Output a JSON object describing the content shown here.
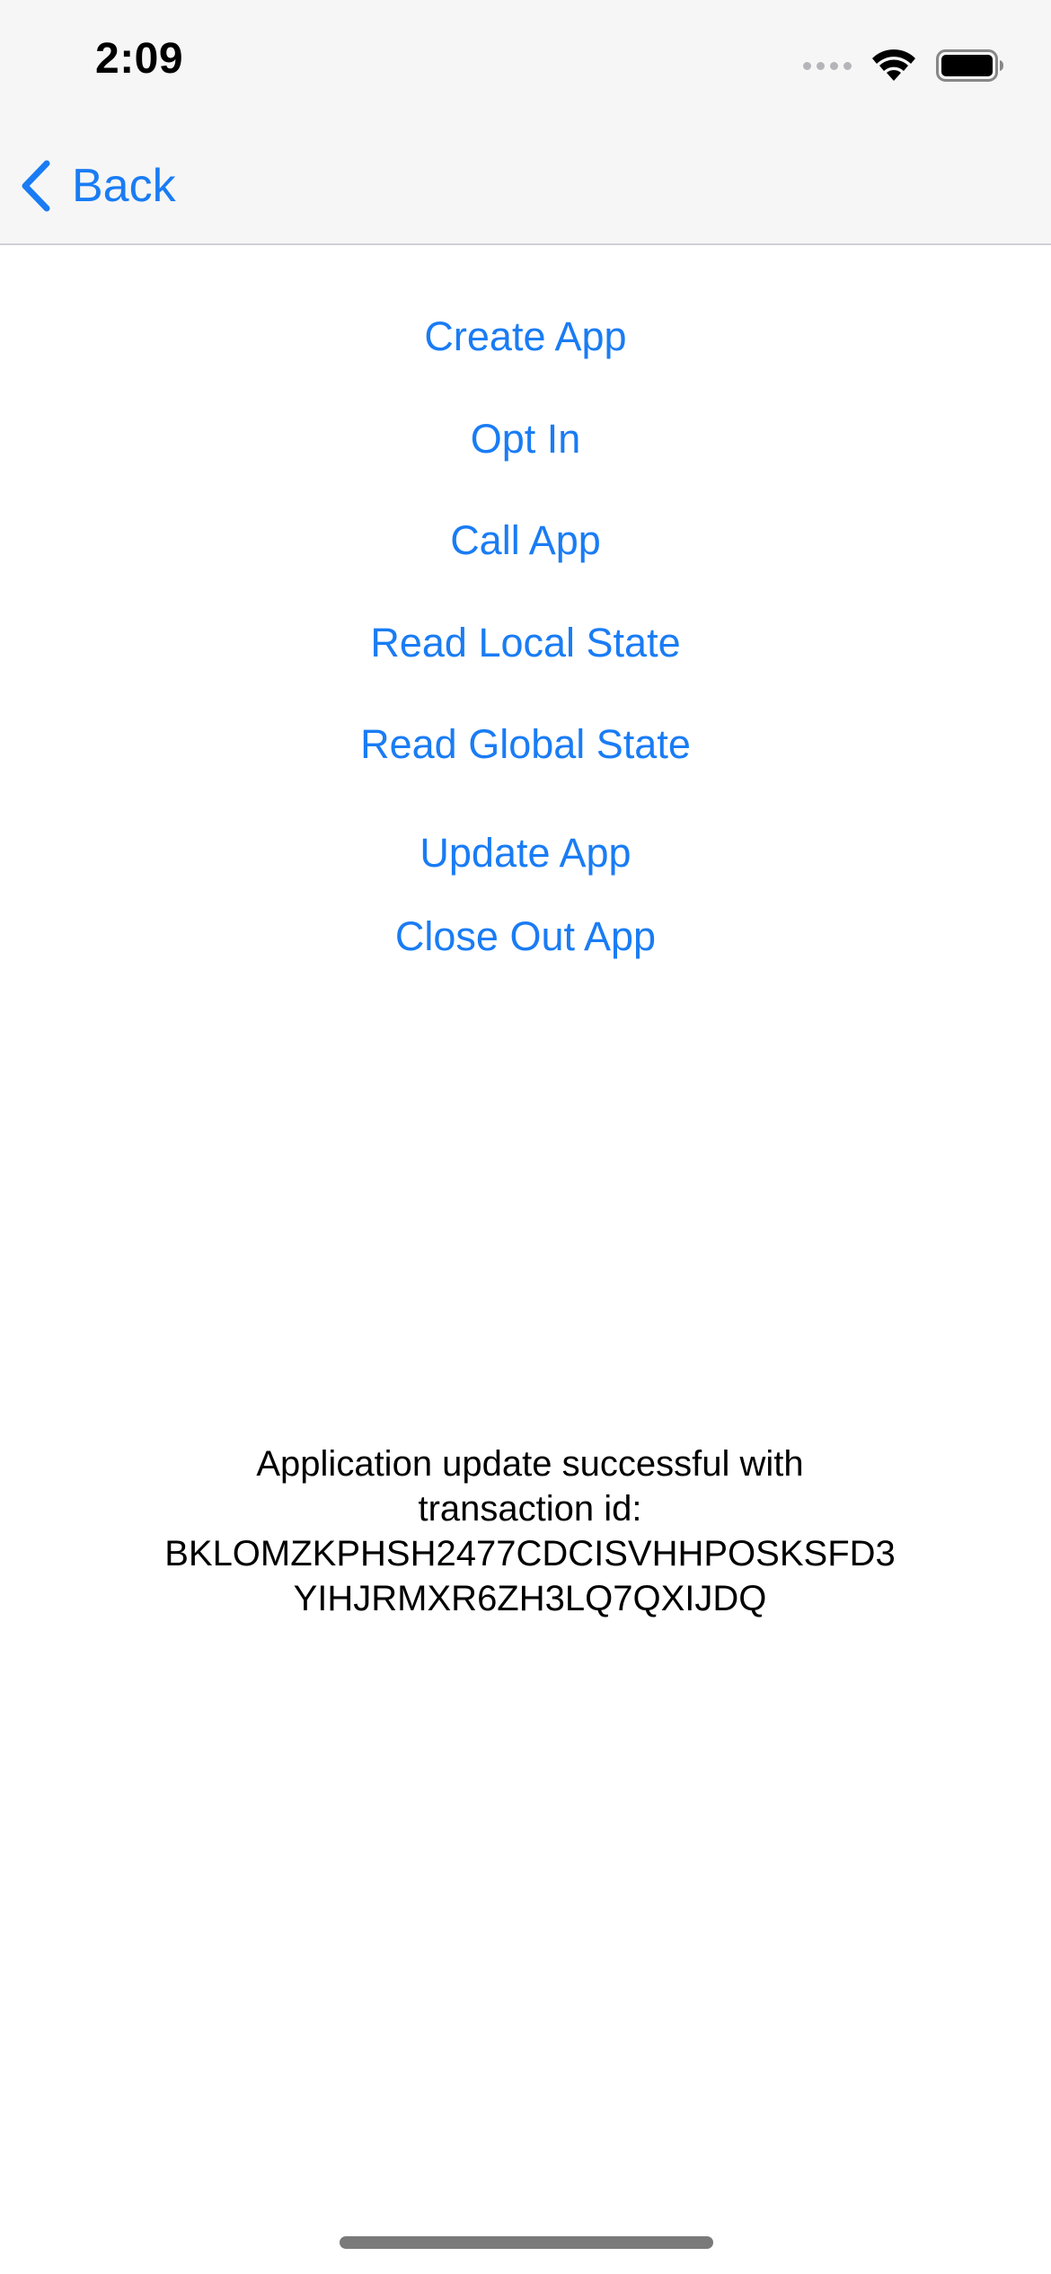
{
  "status_bar": {
    "time": "2:09",
    "icons": [
      "signal-dots-icon",
      "wifi-icon",
      "battery-icon"
    ]
  },
  "nav": {
    "back_label": "Back",
    "accent_color": "#1a7cf4"
  },
  "actions": {
    "create_app": "Create App",
    "opt_in": "Opt In",
    "call_app": "Call App",
    "read_local_state": "Read Local State",
    "read_global_state": "Read Global State",
    "update_app": "Update App",
    "close_out_app": "Close Out App"
  },
  "result": {
    "message": "Application update successful with\ntransaction id:\nBKLOMZKPHSH2477CDCISVHHPOSKSFD3\nYIHJRMXR6ZH3LQ7QXIJDQ"
  }
}
